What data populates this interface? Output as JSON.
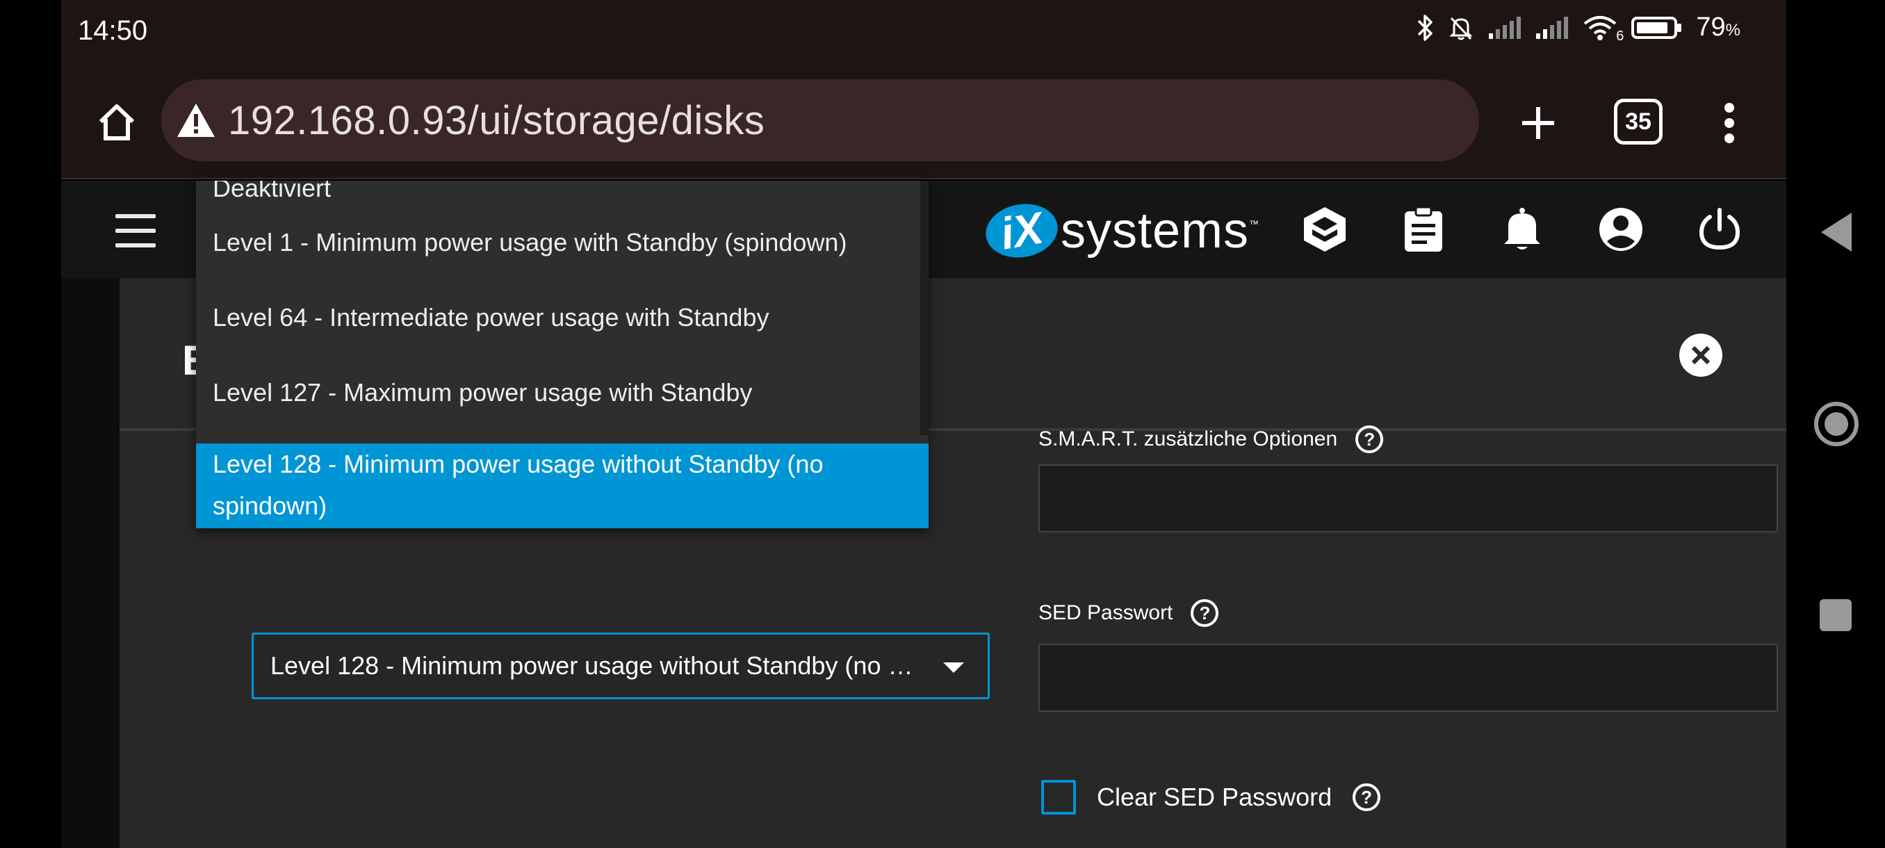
{
  "statusbar": {
    "time": "14:50",
    "battery_percent": "79",
    "battery_unit": "%",
    "wifi_badge": "6",
    "icons": [
      "bluetooth-icon",
      "bell-muted-icon",
      "signal-icon",
      "signal-icon",
      "wifi-icon",
      "battery-icon"
    ]
  },
  "browser": {
    "url": "192.168.0.93/ui/storage/disks",
    "tab_count": "35",
    "icons": [
      "home-icon",
      "warning-icon",
      "plus-icon",
      "tabs-icon",
      "more-vert-icon"
    ]
  },
  "app": {
    "logo_mark": "iX",
    "logo_text": "systems",
    "logo_tm": "™",
    "nav_icons": [
      "truecommand-icon",
      "clipboard-icon",
      "bell-icon",
      "account-icon",
      "power-icon"
    ]
  },
  "dialog": {
    "title_fragment": "E",
    "smart_label": "S.M.A.R.T. zusätzliche Optionen",
    "smart_value": "",
    "sed_password_label": "SED Passwort",
    "sed_password_value": "",
    "clear_sed_label": "Clear SED Password",
    "clear_sed_checked": false,
    "power_select_value": "Level 128 - Minimum power usage without Standby (no s…"
  },
  "dropdown": {
    "options": [
      "Deaktiviert",
      "Level 1 - Minimum power usage with Standby (spindown)",
      "Level 64 - Intermediate power usage with Standby",
      "Level 127 - Maximum power usage with Standby"
    ],
    "selected_line1": "Level 128 - Minimum power usage without Standby (no",
    "selected_line2": "spindown)"
  },
  "colors": {
    "accent": "#0095d5",
    "dialog_bg": "#282828",
    "browser_bg": "#1f1414"
  }
}
